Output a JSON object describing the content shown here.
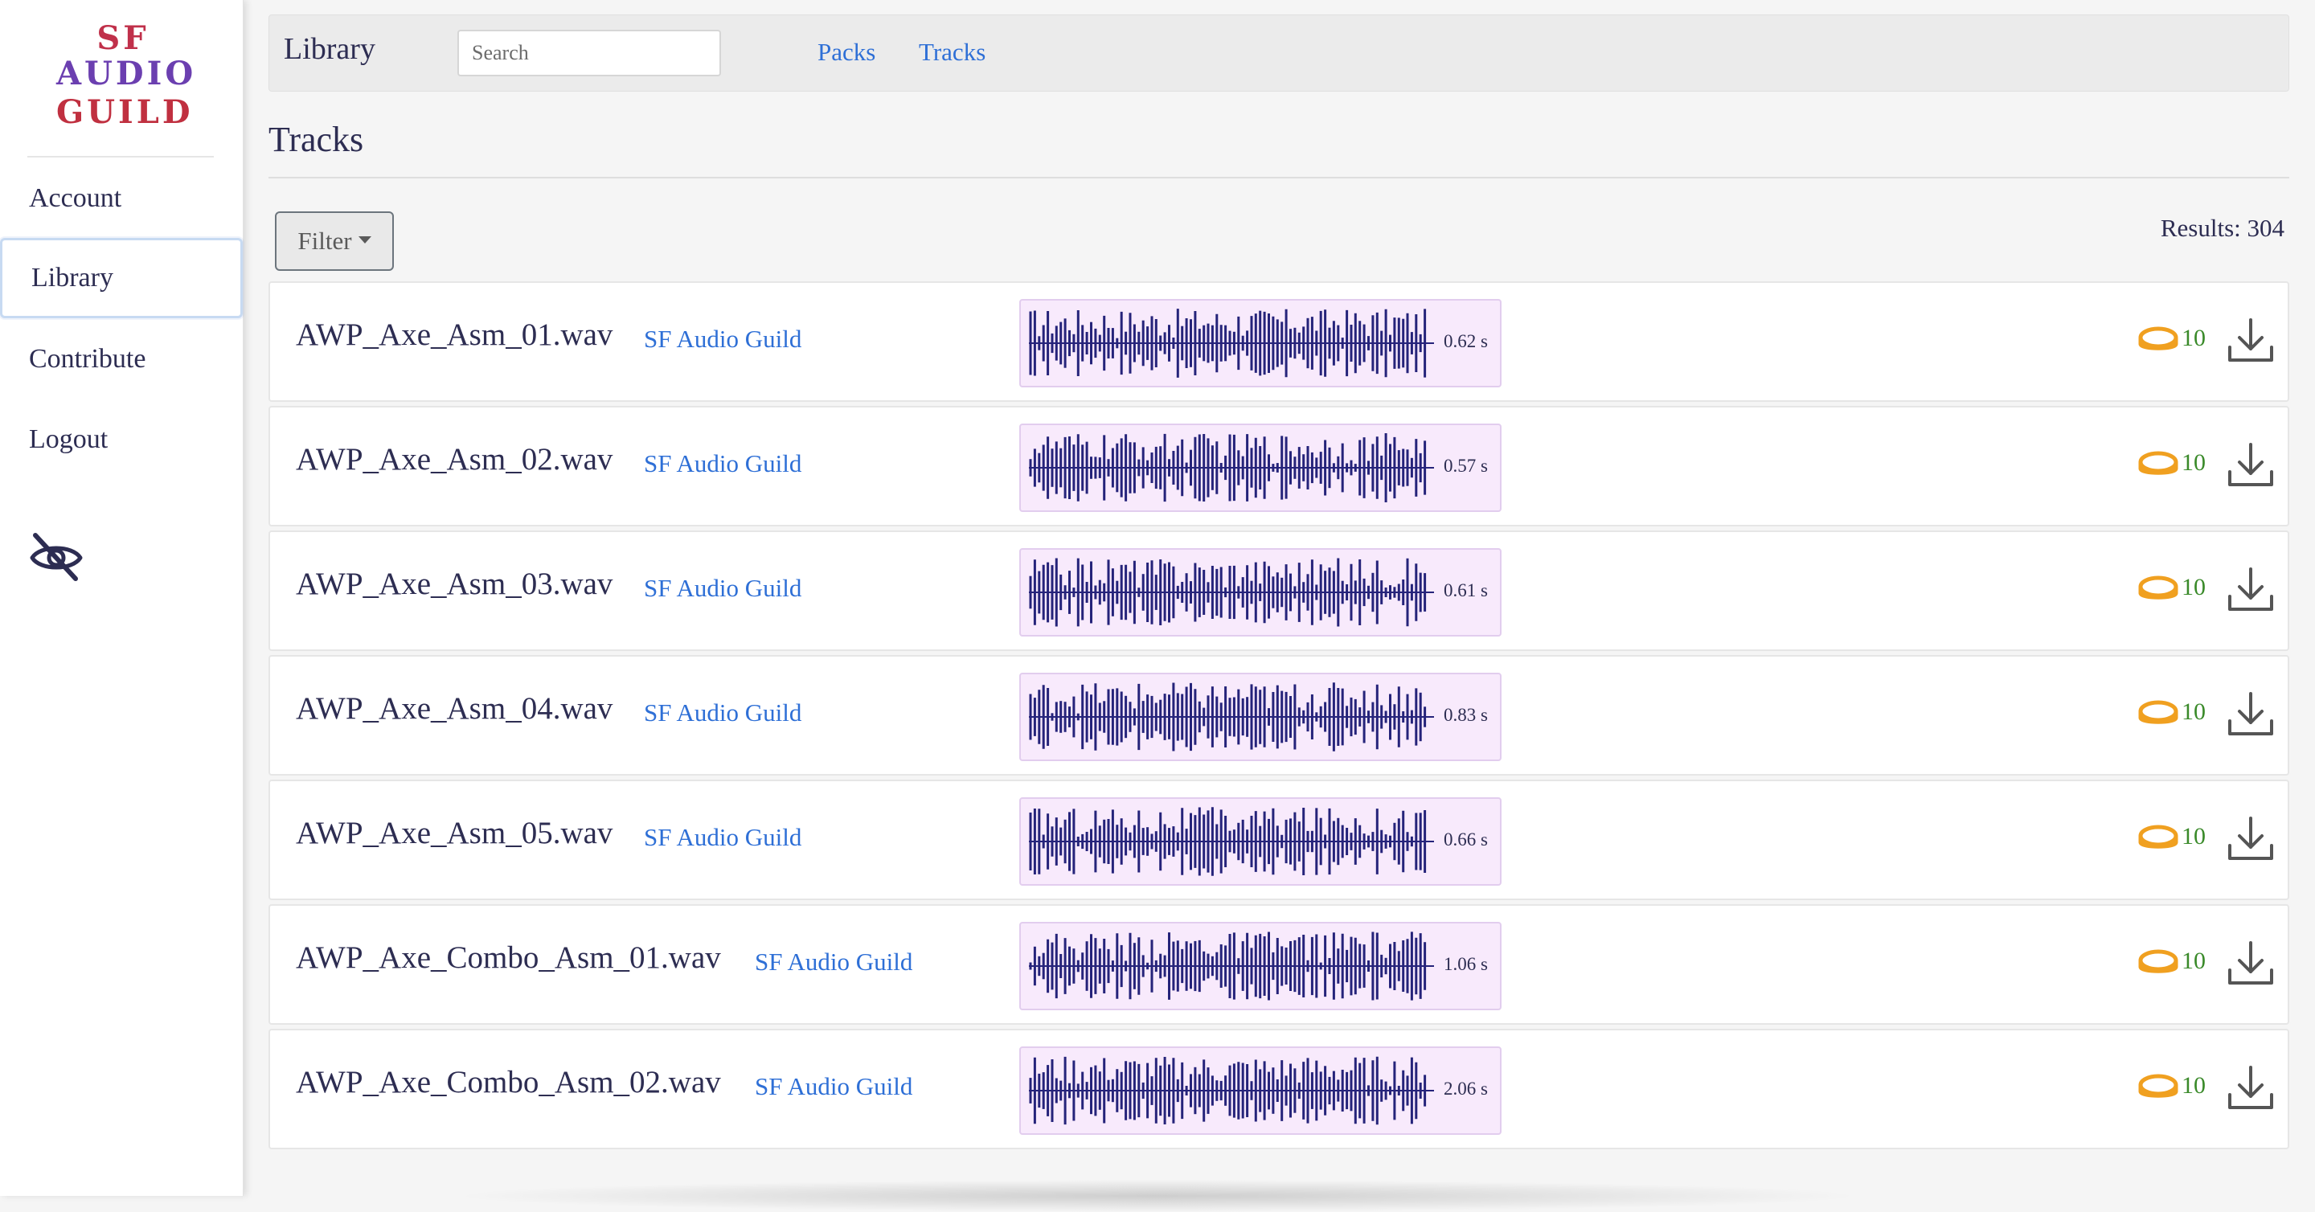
{
  "logo": {
    "lines": [
      "SF",
      "AUDIO",
      "GUILD"
    ]
  },
  "sidebar": {
    "items": [
      {
        "label": "Account"
      },
      {
        "label": "Library",
        "active": true
      },
      {
        "label": "Contribute"
      },
      {
        "label": "Logout"
      }
    ],
    "visibility_icon": "eye-off-icon"
  },
  "topbar": {
    "brand": "Library",
    "search_placeholder": "Search",
    "links": [
      "Packs",
      "Tracks"
    ]
  },
  "page": {
    "title": "Tracks"
  },
  "filter": {
    "label": "Filter"
  },
  "results": {
    "label": "Results: 304"
  },
  "tracks": [
    {
      "name": "AWP_Axe_Asm_01.wav",
      "artist": "SF Audio Guild",
      "duration": "0.62 s",
      "price": "10"
    },
    {
      "name": "AWP_Axe_Asm_02.wav",
      "artist": "SF Audio Guild",
      "duration": "0.57 s",
      "price": "10"
    },
    {
      "name": "AWP_Axe_Asm_03.wav",
      "artist": "SF Audio Guild",
      "duration": "0.61 s",
      "price": "10"
    },
    {
      "name": "AWP_Axe_Asm_04.wav",
      "artist": "SF Audio Guild",
      "duration": "0.83 s",
      "price": "10"
    },
    {
      "name": "AWP_Axe_Asm_05.wav",
      "artist": "SF Audio Guild",
      "duration": "0.66 s",
      "price": "10"
    },
    {
      "name": "AWP_Axe_Combo_Asm_01.wav",
      "artist": "SF Audio Guild",
      "duration": "1.06 s",
      "price": "10"
    },
    {
      "name": "AWP_Axe_Combo_Asm_02.wav",
      "artist": "SF Audio Guild",
      "duration": "2.06 s",
      "price": "10"
    }
  ],
  "icons": {
    "price": "coin-icon",
    "download": "download-icon"
  },
  "colors": {
    "accent": "#2e6fd6",
    "price": "#3a8a2a",
    "coin": "#f0a020",
    "waveform": "#25237a",
    "waveform_bg": "#f8eafc"
  }
}
